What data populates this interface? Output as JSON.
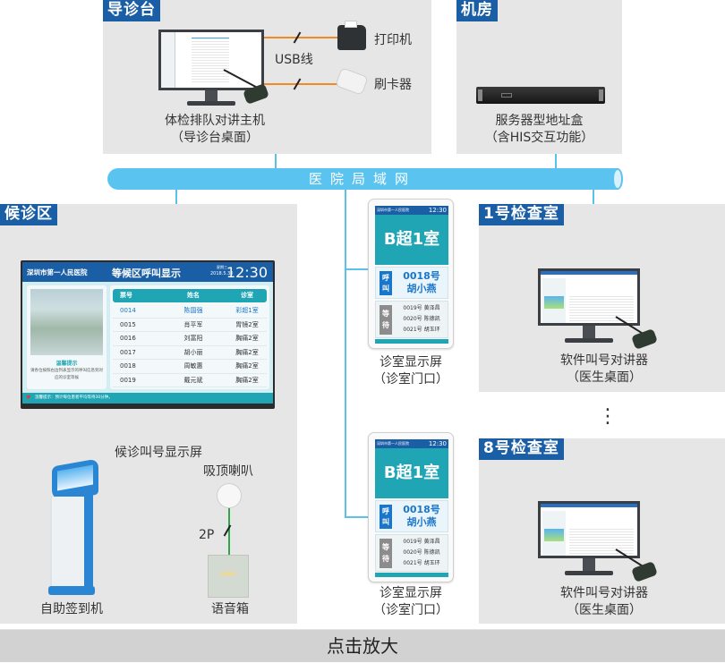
{
  "zones": {
    "guide_desk": {
      "tag": "导诊台"
    },
    "server_room": {
      "tag": "机房"
    },
    "waiting_area": {
      "tag": "候诊区"
    },
    "room_1": {
      "tag": "1号检查室"
    },
    "room_8": {
      "tag": "8号检查室"
    }
  },
  "guide_desk": {
    "host_caption_1": "体检排队对讲主机",
    "host_caption_2": "（导诊台桌面）",
    "usb_label": "USB线",
    "printer_label": "打印机",
    "card_reader_label": "刷卡器"
  },
  "server_room": {
    "caption_1": "服务器型地址盒",
    "caption_2": "（含HIS交互功能）"
  },
  "network": {
    "label": "医院局域网"
  },
  "waiting_screen": {
    "hospital": "深圳市第一人民医院",
    "title": "等候区呼叫显示",
    "weekday": "星期三",
    "date": "2018.5.30",
    "clock": "12:30",
    "notice_title": "温馨提示",
    "notice_text": "请各位按照右边列表显示的呼叫信息到对应的诊室等候",
    "columns": [
      "票号",
      "姓名",
      "诊室"
    ],
    "rows": [
      {
        "no": "0014",
        "name": "陈国强",
        "room": "彩超1室",
        "active": true
      },
      {
        "no": "0015",
        "name": "肖平军",
        "room": "胃镜2室",
        "active": false
      },
      {
        "no": "0016",
        "name": "刘富阳",
        "room": "胸痛2室",
        "active": false
      },
      {
        "no": "0017",
        "name": "胡小丽",
        "room": "胸痛2室",
        "active": false
      },
      {
        "no": "0018",
        "name": "周敏惠",
        "room": "胸痛2室",
        "active": false
      },
      {
        "no": "0019",
        "name": "戴元斌",
        "room": "胸痛2室",
        "active": false
      }
    ],
    "footer": "温馨提示：预计每位患者平均等待30分钟。",
    "caption": "候诊叫号显示屏"
  },
  "waiting_area": {
    "kiosk_caption": "自助签到机",
    "speaker_caption": "吸顶喇叭",
    "wire_label": "2P",
    "amp_caption": "语音箱"
  },
  "door_display": {
    "hospital": "深圳市第一人民医院",
    "clock": "12:30",
    "room": "B超1室",
    "call_tag": "呼叫",
    "call_no": "0018号",
    "call_name": "胡小燕",
    "wait_tag": "等待",
    "waiting": [
      "0019号  黄泽昌",
      "0020号  陈德凯",
      "0021号  胡玉环"
    ],
    "caption_1": "诊室显示屏",
    "caption_2": "（诊室门口）"
  },
  "room_station": {
    "caption_1": "软件叫号对讲器",
    "caption_2": "（医生桌面）"
  },
  "ellipsis": "⋮",
  "zoom_button": "点击放大",
  "colors": {
    "zone_bg": "#e6e6e6",
    "tag_blue": "#1a5ea6",
    "lan_blue": "#5bc3ef",
    "teal": "#1fa5b4",
    "usb_orange": "#f08a24",
    "wire_green": "#2aa84a"
  }
}
